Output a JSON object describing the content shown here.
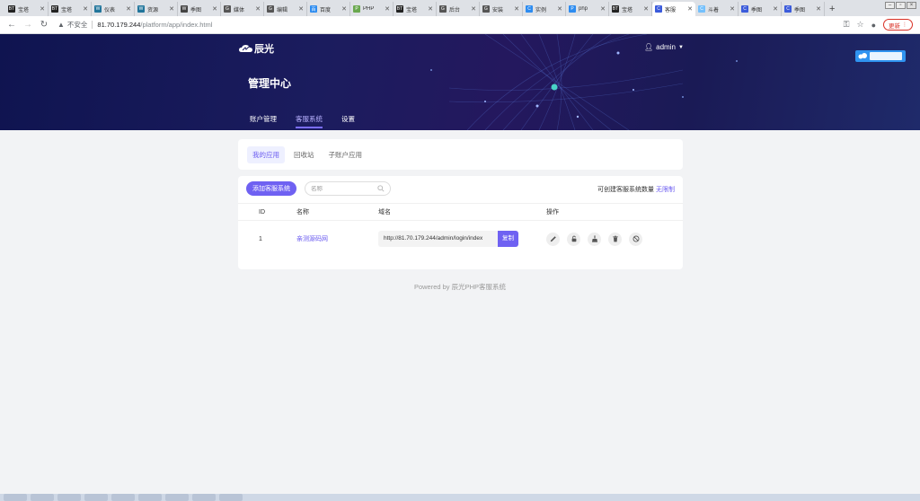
{
  "browser": {
    "tabs": [
      {
        "label": "宝塔",
        "fav": "BT",
        "color": "#222"
      },
      {
        "label": "宝塔",
        "fav": "BT",
        "color": "#222"
      },
      {
        "label": "仪表",
        "fav": "W",
        "color": "#21759b"
      },
      {
        "label": "资源",
        "fav": "W",
        "color": "#21759b"
      },
      {
        "label": "季图",
        "fav": "W",
        "color": "#444"
      },
      {
        "label": "媒体",
        "fav": "G",
        "color": "#555"
      },
      {
        "label": "编辑",
        "fav": "G",
        "color": "#555"
      },
      {
        "label": "百度",
        "fav": "百",
        "color": "#2d8cf0"
      },
      {
        "label": "PHP",
        "fav": "P",
        "color": "#6aa84f"
      },
      {
        "label": "宝塔",
        "fav": "BT",
        "color": "#222"
      },
      {
        "label": "后台",
        "fav": "G",
        "color": "#555"
      },
      {
        "label": "安装",
        "fav": "G",
        "color": "#555"
      },
      {
        "label": "实例",
        "fav": "C",
        "color": "#2d8cf0"
      },
      {
        "label": "php",
        "fav": "P",
        "color": "#2d8cf0"
      },
      {
        "label": "宝塔",
        "fav": "BT",
        "color": "#222"
      },
      {
        "label": "客服",
        "fav": "C",
        "color": "#3b5bdb",
        "active": true
      },
      {
        "label": "斗着",
        "fav": "C",
        "color": "#74c0fc"
      },
      {
        "label": "季图",
        "fav": "C",
        "color": "#3b5bdb"
      },
      {
        "label": "季图",
        "fav": "C",
        "color": "#3b5bdb"
      }
    ],
    "insecure_label": "不安全",
    "url_host": "81.70.179.244",
    "url_path": "/platform/app/index.html",
    "update_label": "更新",
    "newtab": "+",
    "close_glyph": "✕"
  },
  "header": {
    "logo_text": "辰光",
    "user": "admin",
    "title": "管理中心",
    "nav": [
      {
        "label": "账户管理",
        "active": false
      },
      {
        "label": "客服系统",
        "active": true
      },
      {
        "label": "设置",
        "active": false
      }
    ]
  },
  "subtabs": [
    {
      "label": "我的应用",
      "active": true
    },
    {
      "label": "回收站",
      "active": false
    },
    {
      "label": "子账户应用",
      "active": false
    }
  ],
  "toolbar": {
    "add_label": "添加客服系统",
    "search_placeholder": "名称",
    "quota_label": "可创建客服系统数量",
    "quota_value": "无限制"
  },
  "table": {
    "headers": {
      "id": "ID",
      "name": "名称",
      "domain": "域名",
      "ops": "操作"
    },
    "rows": [
      {
        "id": "1",
        "name": "亲测源码网",
        "domain": "http://81.70.179.244/admin/login/index",
        "copy": "复制"
      }
    ],
    "op_icons": [
      "edit-icon",
      "lock-icon",
      "broom-icon",
      "trash-icon",
      "ban-icon"
    ]
  },
  "footer": {
    "text": "Powered by 辰光PHP客服系统"
  }
}
